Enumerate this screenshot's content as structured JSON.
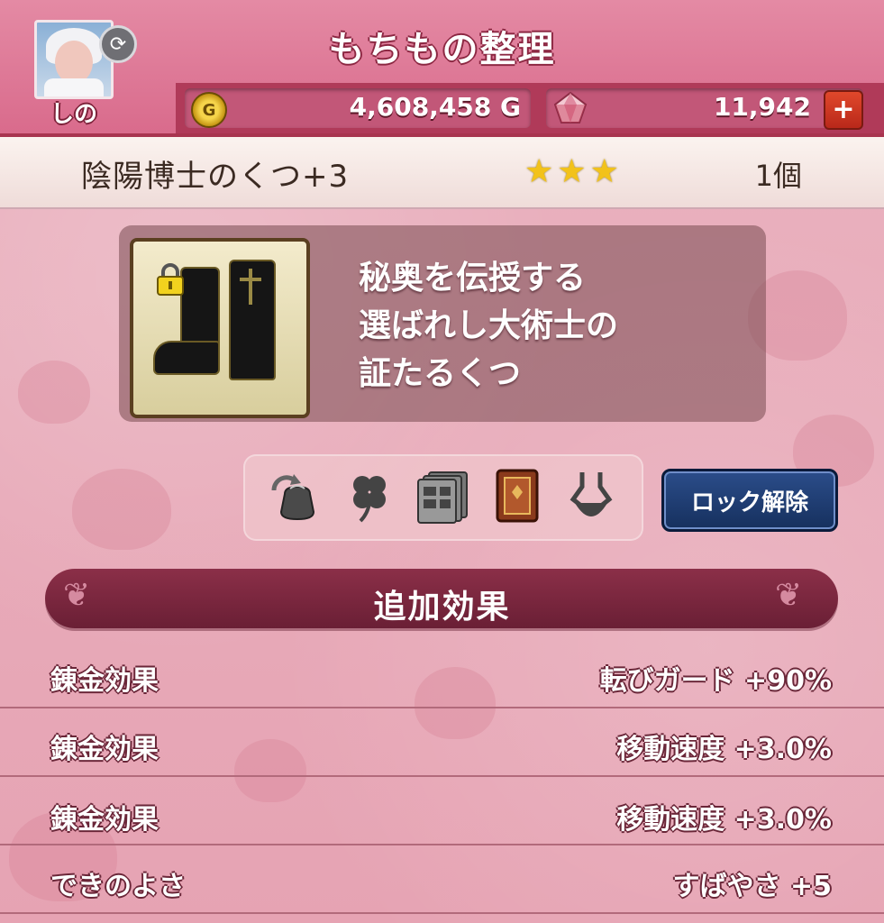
{
  "header": {
    "title": "もちもの整理",
    "player_name": "しの",
    "gold": "4,608,458 G",
    "gems": "11,942",
    "plus_symbol": "+"
  },
  "item": {
    "name": "陰陽博士のくつ+3",
    "stars": 3,
    "star_glyph": "★",
    "count": "1個",
    "description": "秘奥を伝授する\n選ばれし大術士の\n証たるくつ"
  },
  "actions": {
    "icons": [
      "bag-swap-icon",
      "clover-icon",
      "storage-icon",
      "book-icon",
      "dress-icon"
    ],
    "unlock_label": "ロック解除"
  },
  "effects": {
    "section_title": "追加効果",
    "rows": [
      {
        "label": "錬金効果",
        "value": "転びガード +90%"
      },
      {
        "label": "錬金効果",
        "value": "移動速度 +3.0%"
      },
      {
        "label": "錬金効果",
        "value": "移動速度 +3.0%"
      },
      {
        "label": "できのよさ",
        "value": "すばやさ +5"
      }
    ]
  },
  "colors": {
    "header": "#d96b8c",
    "background": "#e9a9b7",
    "section_header": "#7a263f",
    "unlock_button": "#1f3f78",
    "star": "#f2c21a"
  }
}
